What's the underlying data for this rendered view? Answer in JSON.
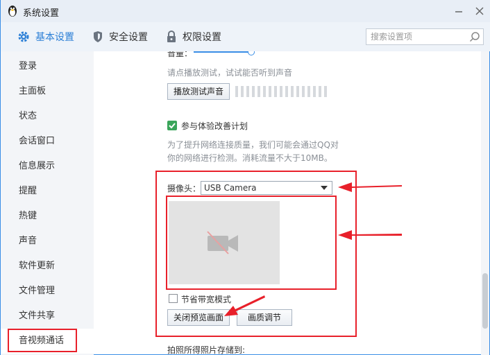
{
  "window": {
    "title": "系统设置"
  },
  "topnav": {
    "tabs": [
      {
        "label": "基本设置",
        "icon": "gear-icon"
      },
      {
        "label": "安全设置",
        "icon": "shield-icon"
      },
      {
        "label": "权限设置",
        "icon": "lock-icon"
      }
    ],
    "search_placeholder": "搜索设置项"
  },
  "sidebar": {
    "items": [
      {
        "label": "登录"
      },
      {
        "label": "主面板"
      },
      {
        "label": "状态"
      },
      {
        "label": "会话窗口"
      },
      {
        "label": "信息展示"
      },
      {
        "label": "提醒"
      },
      {
        "label": "热键"
      },
      {
        "label": "声音"
      },
      {
        "label": "软件更新"
      },
      {
        "label": "文件管理"
      },
      {
        "label": "文件共享"
      },
      {
        "label": "音视频通话"
      }
    ],
    "active": "音视频通话"
  },
  "content": {
    "volume_label": "音量：",
    "play_hint": "请点播放测试，试试能否听到声音",
    "play_button": "播放测试声音",
    "improve_plan_label": "参与体验改善计划",
    "improve_plan_checked": true,
    "improve_desc_line1": "为了提升网络连接质量，我们可能会通过QQ对",
    "improve_desc_line2": "你的网络进行检测。消耗流量不大于10MB。",
    "camera_label": "摄像头：",
    "camera_value": "USB Camera",
    "save_bandwidth_label": "节省带宽模式",
    "save_bandwidth_checked": false,
    "close_preview_button": "关闭预览画面",
    "quality_button": "画质调节",
    "photo_save_label": "拍照所得照片存储到:"
  },
  "colors": {
    "accent": "#2b7fd6",
    "annotation": "#e8202a",
    "check_green": "#3aa55a"
  }
}
